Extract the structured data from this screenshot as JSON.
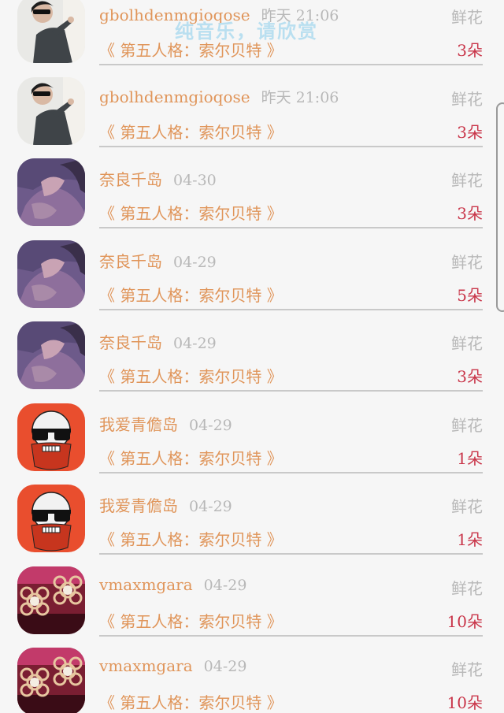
{
  "overlay_text": "纯音乐，请欣赏",
  "gift_label": "鲜花",
  "rows": [
    {
      "name": "gbolhdenmgioqose",
      "time": "昨天 21:06",
      "song": "《 第五人格：索尔贝特 》",
      "count": "3朵",
      "avatar": "person-avatar"
    },
    {
      "name": "gbolhdenmgioqose",
      "time": "昨天 21:06",
      "song": "《 第五人格：索尔贝特 》",
      "count": "3朵",
      "avatar": "person-avatar"
    },
    {
      "name": "奈良千岛",
      "time": "04-30",
      "song": "《 第五人格：索尔贝特 》",
      "count": "3朵",
      "avatar": "purple-avatar"
    },
    {
      "name": "奈良千岛",
      "time": "04-29",
      "song": "《 第五人格：索尔贝特 》",
      "count": "5朵",
      "avatar": "purple-avatar"
    },
    {
      "name": "奈良千岛",
      "time": "04-29",
      "song": "《 第五人格：索尔贝特 》",
      "count": "3朵",
      "avatar": "purple-avatar"
    },
    {
      "name": "我爱青儋岛",
      "time": "04-29",
      "song": "《 第五人格：索尔贝特 》",
      "count": "1朵",
      "avatar": "skull-avatar"
    },
    {
      "name": "我爱青儋岛",
      "time": "04-29",
      "song": "《 第五人格：索尔贝特 》",
      "count": "1朵",
      "avatar": "skull-avatar"
    },
    {
      "name": "vmaxmgara",
      "time": "04-29",
      "song": "《 第五人格：索尔贝特 》",
      "count": "10朵",
      "avatar": "earring-avatar"
    },
    {
      "name": "vmaxmgara",
      "time": "04-29",
      "song": "《 第五人格：索尔贝特 》",
      "count": "10朵",
      "avatar": "earring-avatar"
    }
  ]
}
